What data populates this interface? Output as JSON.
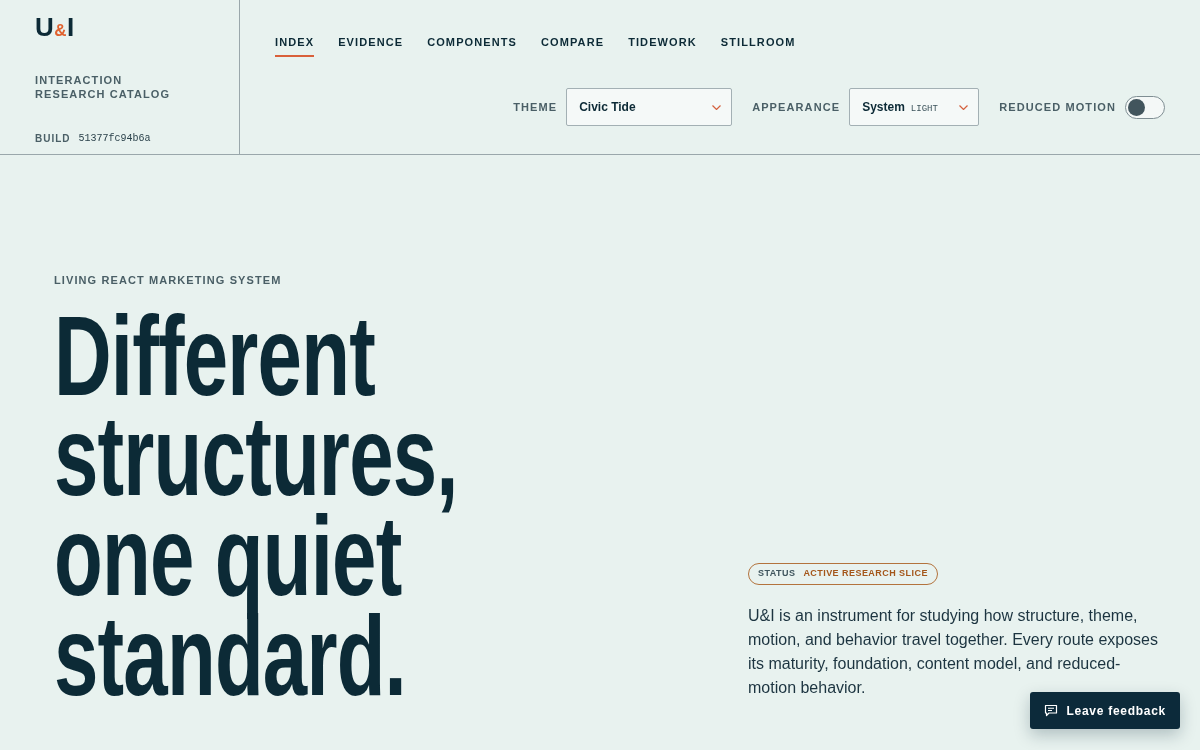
{
  "brand": {
    "logo": [
      {
        "text": "U",
        "kind": "letter"
      },
      {
        "text": "&",
        "kind": "accent"
      },
      {
        "text": "I",
        "kind": "letter"
      }
    ],
    "tagline": "INTERACTION RESEARCH CATALOG",
    "build_label": "BUILD",
    "build_id": "51377fc94b6a"
  },
  "nav": {
    "tabs": [
      {
        "label": "INDEX",
        "selected": true
      },
      {
        "label": "EVIDENCE",
        "selected": false
      },
      {
        "label": "COMPONENTS",
        "selected": false
      },
      {
        "label": "COMPARE",
        "selected": false
      },
      {
        "label": "TIDEWORK",
        "selected": false
      },
      {
        "label": "STILLROOM",
        "selected": false
      }
    ]
  },
  "controls": {
    "theme": {
      "label": "THEME",
      "value": "Civic Tide"
    },
    "appearance": {
      "label": "APPEARANCE",
      "value": "System",
      "mode": "LIGHT"
    },
    "reduced_motion": {
      "label": "REDUCED MOTION",
      "on": false
    }
  },
  "hero": {
    "eyebrow": "LIVING REACT MARKETING SYSTEM",
    "headline": "Different structures, one quiet standard.",
    "status": {
      "label": "STATUS",
      "value": "ACTIVE RESEARCH SLICE"
    },
    "description": "U&I is an instrument for studying how structure, theme, motion, and behavior travel together. Every route exposes its maturity, foundation, content model, and reduced-motion behavior."
  },
  "feedback_button": {
    "label": "Leave feedback"
  }
}
